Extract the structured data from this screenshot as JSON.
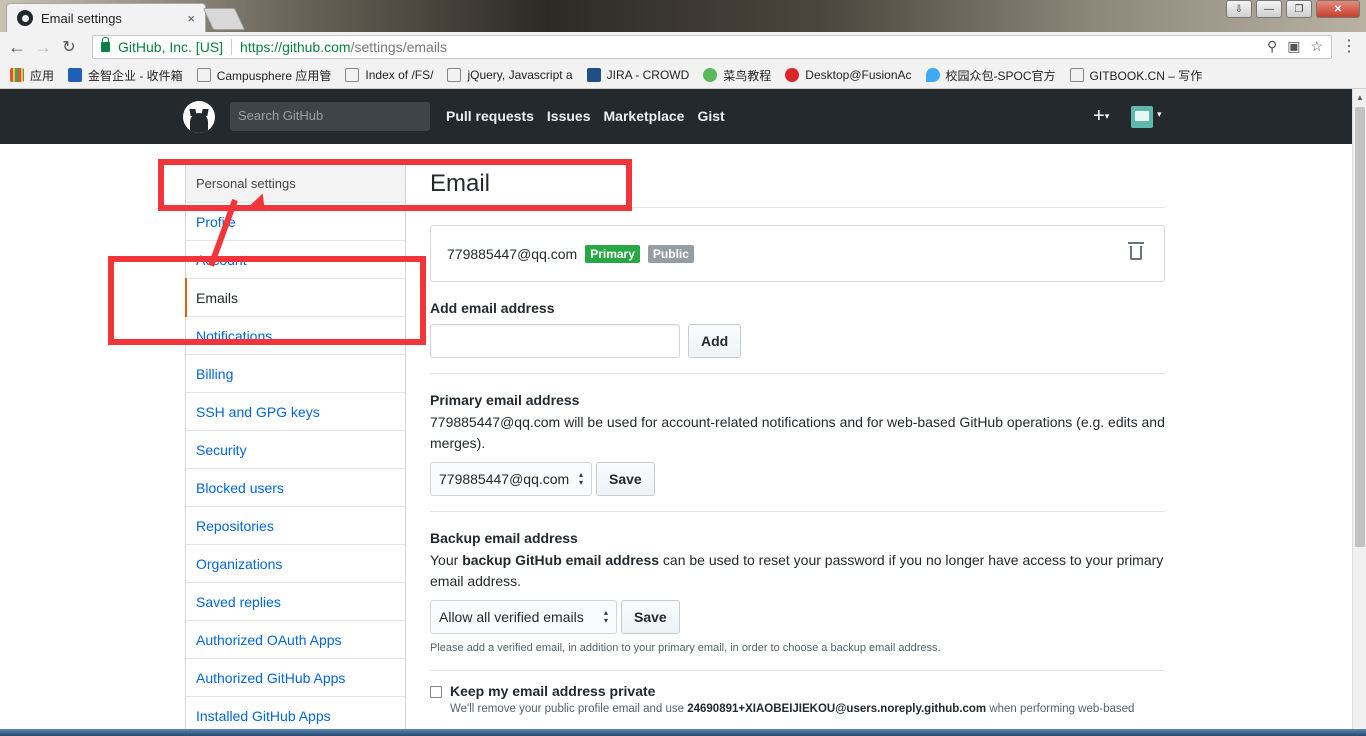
{
  "browser": {
    "tab_title": "Email settings",
    "tab_close": "×",
    "ev_name": "GitHub, Inc. [US]",
    "url_host": "https://github.com",
    "url_path": "/settings/emails",
    "window_controls": [
      "⇩",
      "—",
      "❐",
      "✕"
    ]
  },
  "bookmarks": [
    {
      "label": "应用",
      "color": "#e6533c"
    },
    {
      "label": "金智企业 - 收件箱",
      "color": "#1f5fb5"
    },
    {
      "label": "Campusphere 应用管",
      "color": "#cccccc"
    },
    {
      "label": "Index of /FS/",
      "color": "#cccccc"
    },
    {
      "label": "jQuery, Javascript a",
      "color": "#cccccc"
    },
    {
      "label": "JIRA - CROWD",
      "color": "#205081"
    },
    {
      "label": "菜鸟教程",
      "color": "#5cb85c"
    },
    {
      "label": "Desktop@FusionAc",
      "color": "#d9262c"
    },
    {
      "label": "校园众包-SPOC官方",
      "color": "#3fa9f5"
    },
    {
      "label": "GITBOOK.CN – 写作",
      "color": "#cccccc"
    }
  ],
  "header": {
    "search_placeholder": "Search GitHub",
    "nav": [
      "Pull requests",
      "Issues",
      "Marketplace",
      "Gist"
    ],
    "plus": "+"
  },
  "sidebar": {
    "heading": "Personal settings",
    "items": [
      "Profile",
      "Account",
      "Emails",
      "Notifications",
      "Billing",
      "SSH and GPG keys",
      "Security",
      "Blocked users",
      "Repositories",
      "Organizations",
      "Saved replies",
      "Authorized OAuth Apps",
      "Authorized GitHub Apps",
      "Installed GitHub Apps"
    ],
    "selected": "Emails"
  },
  "main": {
    "title": "Email",
    "email": {
      "address": "779885447@qq.com",
      "primary_label": "Primary",
      "public_label": "Public"
    },
    "add": {
      "label": "Add email address",
      "button": "Add",
      "value": ""
    },
    "primary": {
      "label": "Primary email address",
      "description": "779885447@qq.com will be used for account-related notifications and for web-based GitHub operations (e.g. edits and merges).",
      "selected": "779885447@qq.com",
      "save": "Save"
    },
    "backup": {
      "label": "Backup email address",
      "desc_pre": "Your ",
      "desc_bold": "backup GitHub email address",
      "desc_post": " can be used to reset your password if you no longer have access to your primary email address.",
      "selected": "Allow all verified emails",
      "save": "Save",
      "note": "Please add a verified email, in addition to your primary email, in order to choose a backup email address."
    },
    "private": {
      "label": "Keep my email address private",
      "desc_pre": "We'll remove your public profile email and use ",
      "desc_bold": "24690891+XIAOBEIJIEKOU@users.noreply.github.com",
      "desc_post": " when performing web-based"
    }
  },
  "colors": {
    "annotation": "#f2353b",
    "primary_label": "#28a745",
    "public_label": "#959da5",
    "link": "#0366d6",
    "header_bg": "#24292e"
  }
}
